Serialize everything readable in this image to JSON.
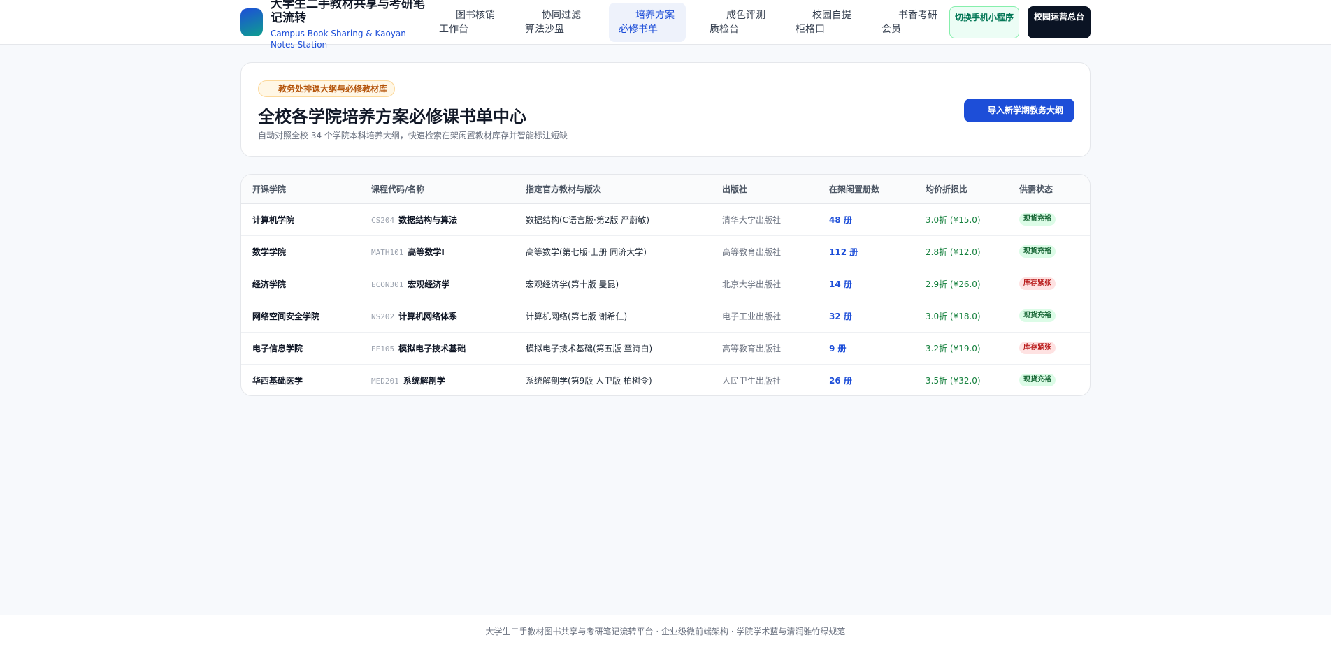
{
  "brand": {
    "title": "大学生二手教材共享与考研笔记流转",
    "subtitle": "Campus Book Sharing & Kaoyan Notes Station"
  },
  "nav": [
    {
      "label": "图书核销工作台"
    },
    {
      "label": "协同过滤算法沙盘"
    },
    {
      "label": "培养方案必修书单"
    },
    {
      "label": "成色评测质检台"
    },
    {
      "label": "校园自提柜格口"
    },
    {
      "label": "书香考研会员"
    }
  ],
  "header_buttons": {
    "mini": "切换手机小程序",
    "ops": "校园运营总台"
  },
  "hero": {
    "badge": "教务处排课大纲与必修教材库",
    "title": "全校各学院培养方案必修课书单中心",
    "desc": "自动对照全校 34 个学院本科培养大纲，快速检索在架闲置教材库存并智能标注短缺",
    "button": "导入新学期教务大纲"
  },
  "table": {
    "headers": [
      "开课学院",
      "课程代码/名称",
      "指定官方教材与版次",
      "出版社",
      "在架闲置册数",
      "均价折损比",
      "供需状态"
    ],
    "rows": [
      {
        "college": "计算机学院",
        "code": "CS204",
        "course": "数据结构与算法",
        "textbook": "数据结构(C语言版·第2版 严蔚敏)",
        "publisher": "清华大学出版社",
        "stock": "48 册",
        "discount": "3.0折 (¥15.0)",
        "status": "现货充裕",
        "status_level": "ok"
      },
      {
        "college": "数学学院",
        "code": "MATH101",
        "course": "高等数学I",
        "textbook": "高等数学(第七版·上册 同济大学)",
        "publisher": "高等教育出版社",
        "stock": "112 册",
        "discount": "2.8折 (¥12.0)",
        "status": "现货充裕",
        "status_level": "ok"
      },
      {
        "college": "经济学院",
        "code": "ECON301",
        "course": "宏观经济学",
        "textbook": "宏观经济学(第十版 曼昆)",
        "publisher": "北京大学出版社",
        "stock": "14 册",
        "discount": "2.9折 (¥26.0)",
        "status": "库存紧张",
        "status_level": "low"
      },
      {
        "college": "网络空间安全学院",
        "code": "NS202",
        "course": "计算机网络体系",
        "textbook": "计算机网络(第七版 谢希仁)",
        "publisher": "电子工业出版社",
        "stock": "32 册",
        "discount": "3.0折 (¥18.0)",
        "status": "现货充裕",
        "status_level": "ok"
      },
      {
        "college": "电子信息学院",
        "code": "EE105",
        "course": "模拟电子技术基础",
        "textbook": "模拟电子技术基础(第五版 童诗白)",
        "publisher": "高等教育出版社",
        "stock": "9 册",
        "discount": "3.2折 (¥19.0)",
        "status": "库存紧张",
        "status_level": "low"
      },
      {
        "college": "华西基础医学",
        "code": "MED201",
        "course": "系统解剖学",
        "textbook": "系统解剖学(第9版 人卫版 柏树令)",
        "publisher": "人民卫生出版社",
        "stock": "26 册",
        "discount": "3.5折 (¥32.0)",
        "status": "现货充裕",
        "status_level": "ok"
      }
    ]
  },
  "footer": "大学生二手教材图书共享与考研笔记流转平台 · 企业级微前端架构 · 学院学术蓝与清润雅竹绿规范",
  "colors": {
    "accent": "#1d4ed8",
    "green": "#15803d",
    "danger": "#b91c1c",
    "dark": "#0b1424"
  }
}
